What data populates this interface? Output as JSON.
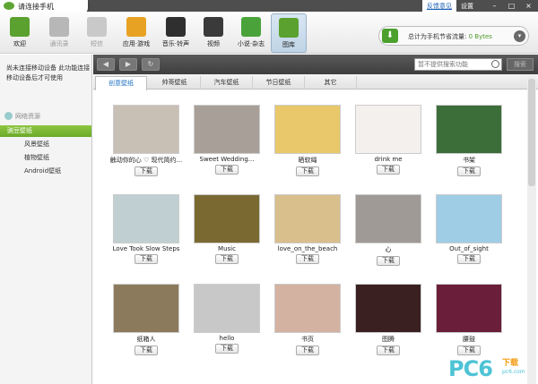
{
  "window": {
    "title": "请连接手机"
  },
  "title_links": {
    "feedback": "反馈意见",
    "settings": "设置"
  },
  "window_controls": {
    "minimize": "–",
    "maximize": "□",
    "close": "×"
  },
  "toolbar": {
    "items": [
      {
        "label": "欢迎",
        "icon": "pea-icon",
        "color": "#5aa12f"
      },
      {
        "label": "通讯录",
        "icon": "contacts-icon",
        "color": "#b7b7b7"
      },
      {
        "label": "短信",
        "icon": "sms-icon",
        "color": "#c9c9c9"
      },
      {
        "label": "应用·游戏",
        "icon": "apps-icon",
        "color": "#e8a223"
      },
      {
        "label": "音乐·铃声",
        "icon": "headphones-icon",
        "color": "#2f2f2f"
      },
      {
        "label": "视频",
        "icon": "film-icon",
        "color": "#3a3a3a"
      },
      {
        "label": "小说·杂志",
        "icon": "book-icon",
        "color": "#4aa33a"
      },
      {
        "label": "图库",
        "icon": "picture-icon",
        "color": "#5aa12f"
      }
    ]
  },
  "traffic": {
    "label": "总计为手机节省流量:",
    "value": "0 Bytes",
    "icon": "download-arrow-icon",
    "btn": "▾"
  },
  "sidebar": {
    "message": "尚未连接移动设备 此功能连接移动设备后才可使用",
    "section": "网络资源",
    "active": "豌豆壁纸",
    "items": [
      "风景壁纸",
      "植物壁纸",
      "Android壁纸"
    ]
  },
  "nav": {
    "back": "◀",
    "forward": "▶",
    "refresh": "↻",
    "search_placeholder": "暂不提供搜索功能",
    "search_btn": "搜索"
  },
  "tabs": [
    "创意壁纸",
    "帅哥壁纸",
    "汽车壁纸",
    "节日壁纸",
    "其它"
  ],
  "download_label": "下载",
  "wallpapers": [
    {
      "caption": "触动你的心 ♡ 现代简约...",
      "color": "#c8c0b4"
    },
    {
      "caption": "Sweet Wedding...",
      "color": "#a8a098"
    },
    {
      "caption": "晒软绳",
      "color": "#e8c86a"
    },
    {
      "caption": "drink me",
      "color": "#f4f0ee"
    },
    {
      "caption": "书架",
      "color": "#3c6e3a"
    },
    {
      "caption": "Love Took Slow Steps",
      "color": "#c0cfd2"
    },
    {
      "caption": "Music",
      "color": "#7a6a32"
    },
    {
      "caption": "love_on_the_beach",
      "color": "#d8bf8c"
    },
    {
      "caption": "心",
      "color": "#a09a96"
    },
    {
      "caption": "Out_of_sight",
      "color": "#9fcde6"
    },
    {
      "caption": "纸箱人",
      "color": "#8c7a5c"
    },
    {
      "caption": "hello",
      "color": "#c8c8c8"
    },
    {
      "caption": "书页",
      "color": "#d4b2a2"
    },
    {
      "caption": "图腾",
      "color": "#3a2020"
    },
    {
      "caption": "腰鼓",
      "color": "#6a1e3a"
    }
  ],
  "watermark": {
    "text": "PC6",
    "sub": "下载",
    "url": "pc6.com"
  }
}
